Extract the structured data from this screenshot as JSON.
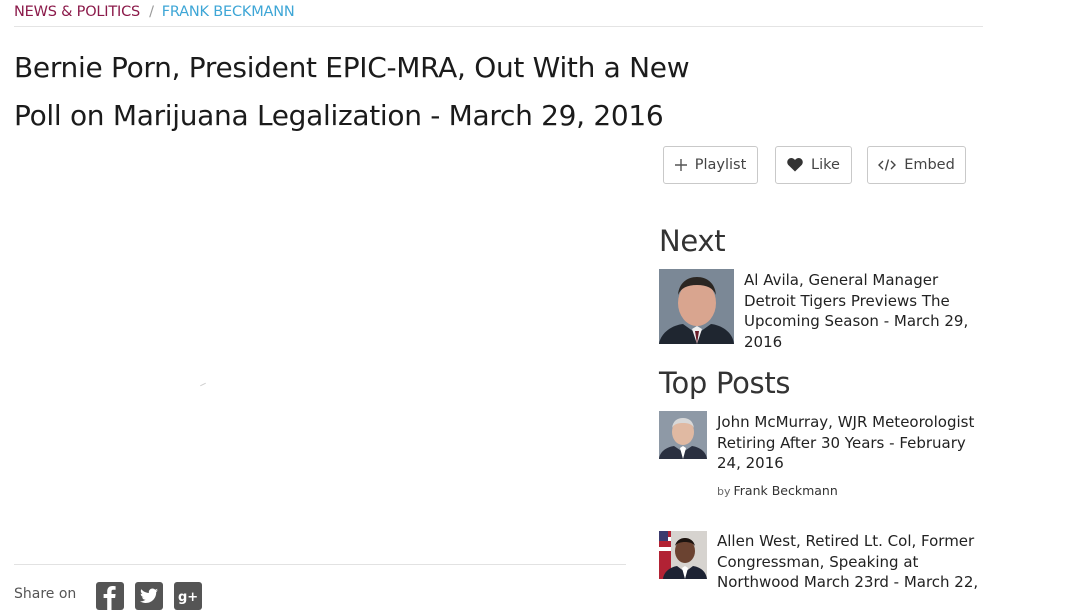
{
  "breadcrumb": {
    "category": "NEWS & POLITICS",
    "separator": "/",
    "author": "FRANK BECKMANN"
  },
  "post": {
    "title": "Bernie Porn, President EPIC-MRA, Out With a New Poll on Marijuana Legalization - March 29, 2016"
  },
  "share": {
    "label": "Share on"
  },
  "actions": {
    "playlist": "Playlist",
    "like": "Like",
    "embed": "Embed"
  },
  "next": {
    "heading": "Next",
    "item": {
      "title": "Al Avila, General Manager Detroit Tigers Previews The Upcoming Season - March 29, 2016"
    }
  },
  "top_posts": {
    "heading": "Top Posts",
    "items": [
      {
        "title": "John McMurray, WJR Meteorologist Retiring After 30 Years - February 24, 2016",
        "by": "by",
        "author": "Frank Beckmann"
      },
      {
        "title": "Allen West, Retired Lt. Col, Former Congressman, Speaking at Northwood March 23rd - March 22,"
      }
    ]
  },
  "colors": {
    "category": "#8b1a4a",
    "author_link": "#3ea6d6",
    "border": "#c9c9c9"
  },
  "icons": [
    "plus-icon",
    "heart-icon",
    "code-icon",
    "facebook-icon",
    "twitter-icon",
    "google-plus-icon"
  ]
}
